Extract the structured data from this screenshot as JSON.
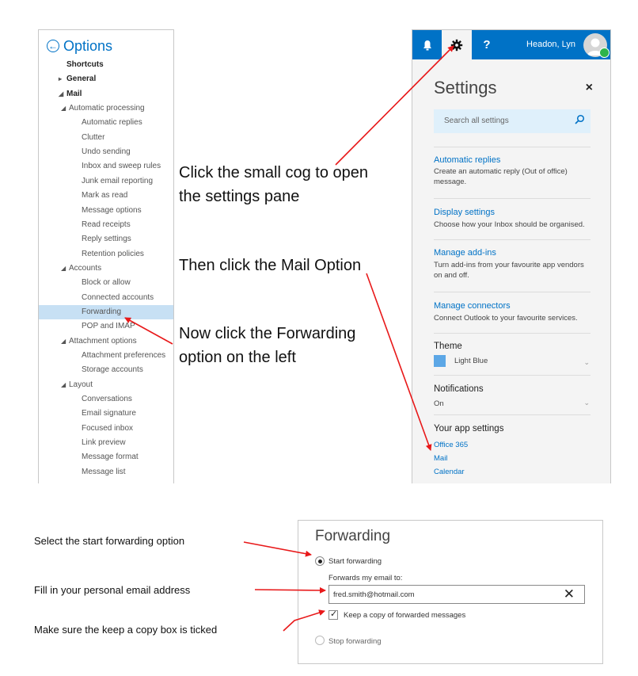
{
  "options": {
    "title": "Options",
    "items": [
      {
        "label": "Shortcuts"
      },
      {
        "label": "General",
        "caret": "▸"
      },
      {
        "label": "Mail",
        "caret": "◢"
      },
      {
        "label": "Automatic processing",
        "caret": "◢"
      },
      {
        "label": "Automatic replies"
      },
      {
        "label": "Clutter"
      },
      {
        "label": "Undo sending"
      },
      {
        "label": "Inbox and sweep rules"
      },
      {
        "label": "Junk email reporting"
      },
      {
        "label": "Mark as read"
      },
      {
        "label": "Message options"
      },
      {
        "label": "Read receipts"
      },
      {
        "label": "Reply settings"
      },
      {
        "label": "Retention policies"
      },
      {
        "label": "Accounts",
        "caret": "◢"
      },
      {
        "label": "Block or allow"
      },
      {
        "label": "Connected accounts"
      },
      {
        "label": "Forwarding"
      },
      {
        "label": "POP and IMAP"
      },
      {
        "label": "Attachment options",
        "caret": "◢"
      },
      {
        "label": "Attachment preferences"
      },
      {
        "label": "Storage accounts"
      },
      {
        "label": "Layout",
        "caret": "◢"
      },
      {
        "label": "Conversations"
      },
      {
        "label": "Email signature"
      },
      {
        "label": "Focused inbox"
      },
      {
        "label": "Link preview"
      },
      {
        "label": "Message format"
      },
      {
        "label": "Message list"
      }
    ]
  },
  "topbar": {
    "help": "?",
    "user_name": "Headon, Lyn",
    "icons": [
      "bell-icon",
      "gear-icon",
      "help-icon",
      "user-avatar-icon"
    ],
    "accent": "#0072c6"
  },
  "settings": {
    "title": "Settings",
    "close": "×",
    "search_placeholder": "Search all settings",
    "sections": {
      "auto_replies": {
        "title": "Automatic replies",
        "desc": "Create an automatic reply (Out of office) message."
      },
      "display": {
        "title": "Display settings",
        "desc": "Choose how your Inbox should be organised."
      },
      "addins": {
        "title": "Manage add-ins",
        "desc": "Turn add-ins from your favourite app vendors on and off."
      },
      "connectors": {
        "title": "Manage connectors",
        "desc": "Connect Outlook to your favourite services."
      }
    },
    "theme": {
      "label": "Theme",
      "value": "Light Blue",
      "swatch": "#5ca7e6"
    },
    "notifications": {
      "label": "Notifications",
      "value": "On"
    },
    "app_settings": {
      "label": "Your app settings",
      "links": [
        "Office 365",
        "Mail",
        "Calendar"
      ]
    }
  },
  "annotations": {
    "cog_line1": "Click the small cog to open",
    "cog_line2": "the settings pane",
    "mail": "Then click the Mail Option",
    "forwarding_line1": "Now click the Forwarding",
    "forwarding_line2": "option on the left",
    "select_start": "Select the start forwarding option",
    "fill_email": "Fill in your personal email address",
    "keep_copy": "Make sure the keep a copy box is ticked",
    "arrow_color": "#e8191a"
  },
  "forwarding": {
    "title": "Forwarding",
    "start_label": "Start forwarding",
    "forwards_to_label": "Forwards my email to:",
    "email_value": "fred.smith@hotmail.com",
    "clear": "✕",
    "keep_copy_label": "Keep a copy of forwarded messages",
    "stop_label": "Stop forwarding"
  }
}
